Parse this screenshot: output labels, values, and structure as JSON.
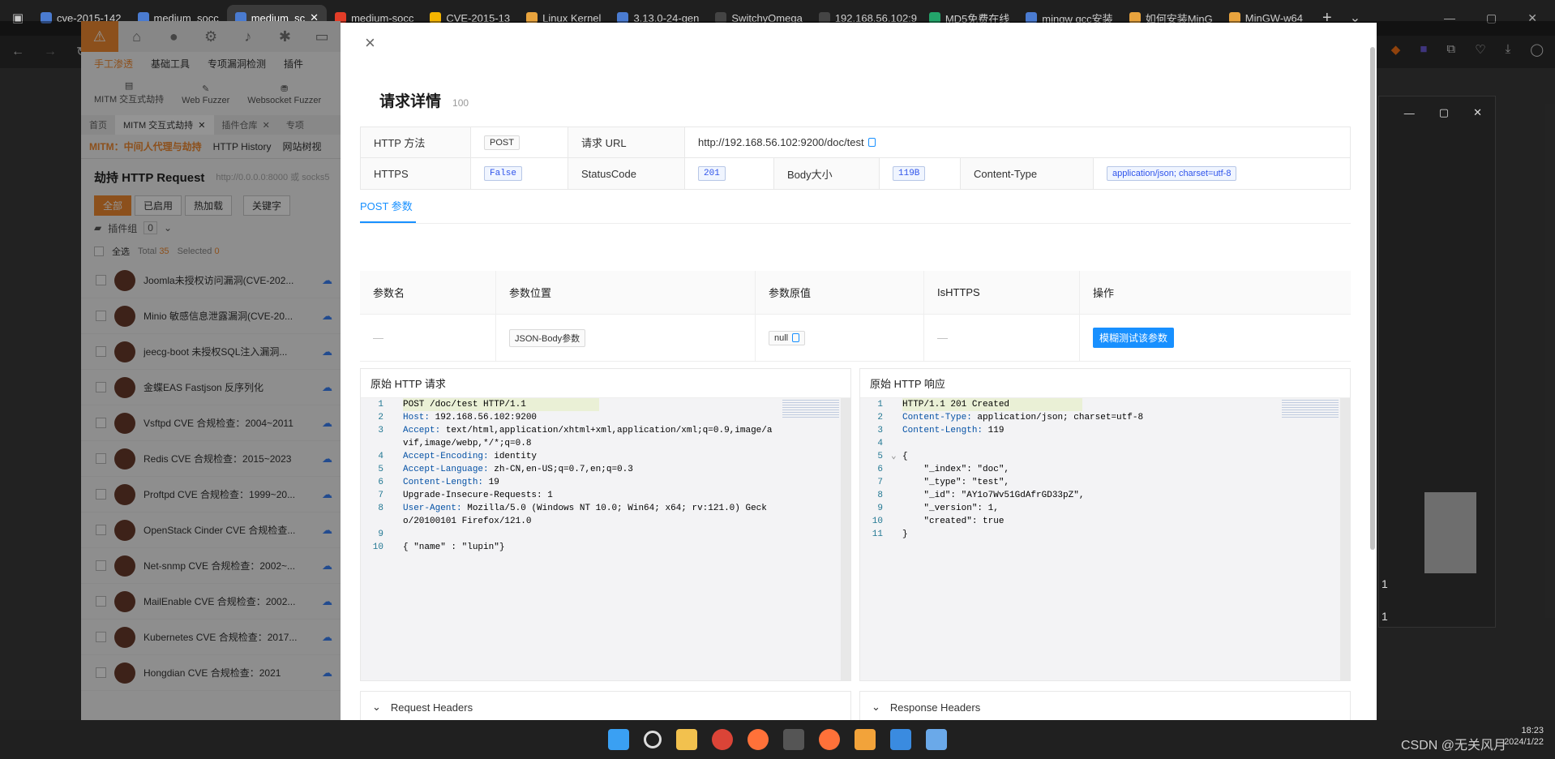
{
  "browser": {
    "tabs": [
      {
        "label": "cve-2015-142",
        "color": "#4a7bd0"
      },
      {
        "label": "medium_socc",
        "color": "#4a7bd0"
      },
      {
        "label": "medium_sc",
        "color": "#4a7bd0",
        "active": true
      },
      {
        "label": "medium-socc",
        "color": "#e23d28"
      },
      {
        "label": "CVE-2015-13",
        "color": "#f4b400"
      },
      {
        "label": "Linux Kernel",
        "color": "#e8a33d"
      },
      {
        "label": "3.13.0-24-gen",
        "color": "#4a7bd0"
      },
      {
        "label": "SwitchyOmega",
        "color": "#444"
      },
      {
        "label": "192.168.56.102:9",
        "color": "#444"
      },
      {
        "label": "MD5免费在线",
        "color": "#23a46a"
      },
      {
        "label": "mingw gcc安装",
        "color": "#4a7bd0"
      },
      {
        "label": "如何安装MinG",
        "color": "#e8a33d"
      },
      {
        "label": "MinGW-w64",
        "color": "#e8a33d"
      }
    ],
    "new_tab": "+",
    "dropdown": "⌄"
  },
  "app": {
    "menu": [
      "手工渗透",
      "基础工具",
      "专项漏洞检测",
      "插件"
    ],
    "tools": [
      "MITM 交互式劫持",
      "Web Fuzzer",
      "Websocket Fuzzer"
    ],
    "tabs": [
      "首页",
      "MITM 交互式劫持",
      "插件仓库",
      "专项"
    ],
    "sub_tabs": [
      "MITM：中间人代理与劫持",
      "HTTP History",
      "网站树视"
    ],
    "title": "劫持 HTTP Request",
    "title_hint": "http://0.0.0.0:8000 或 socks5",
    "filters": [
      "全部",
      "已启用",
      "热加载",
      "关键字"
    ],
    "plugin_group": "插件组",
    "plugin_group_count": "0",
    "select_all": "全选",
    "total_label": "Total",
    "total": "35",
    "selected_label": "Selected",
    "selected": "0",
    "plugins": [
      "Joomla未授权访问漏洞(CVE-202...",
      "Minio 敏感信息泄露漏洞(CVE-20...",
      "jeecg-boot 未授权SQL注入漏洞...",
      "金蝶EAS Fastjson 反序列化",
      "Vsftpd CVE 合规检查：2004~2011",
      "Redis CVE 合规检查：2015~2023",
      "Proftpd CVE 合规检查：1999~20...",
      "OpenStack Cinder CVE 合规检查...",
      "Net-snmp CVE 合规检查：2002~...",
      "MailEnable CVE 合规检查：2002...",
      "Kubernetes CVE 合规检查：2017...",
      "Hongdian CVE 合规检查：2021"
    ]
  },
  "modal": {
    "close": "×",
    "title": "请求详情",
    "id": "100",
    "labels": {
      "method": "HTTP 方法",
      "url": "请求 URL",
      "https": "HTTPS",
      "status": "StatusCode",
      "body_size": "Body大小",
      "content_type": "Content-Type"
    },
    "values": {
      "method": "POST",
      "url": "http://192.168.56.102:9200/doc/test",
      "https": "False",
      "status": "201",
      "body_size": "119B",
      "content_type": "application/json; charset=utf-8"
    },
    "post_tab": "POST 参数",
    "param_headers": [
      "参数名",
      "参数位置",
      "参数原值",
      "IsHTTPS",
      "操作"
    ],
    "param_row": {
      "name": "—",
      "position": "JSON-Body参数",
      "value": "null",
      "is_https": "—",
      "action": "模糊测试该参数"
    },
    "request_title": "原始 HTTP 请求",
    "response_title": "原始 HTTP 响应",
    "request_headers": "Request Headers",
    "response_headers": "Response Headers"
  },
  "request_lines": [
    {
      "n": "1",
      "k": "",
      "v": "POST /doc/test HTTP/1.1"
    },
    {
      "n": "2",
      "k": "Host:",
      "v": " 192.168.56.102:9200"
    },
    {
      "n": "3",
      "k": "Accept:",
      "v": " text/html,application/xhtml+xml,application/xml;q=0.9,image/avif,image/webp,*/*;q=0.8"
    },
    {
      "n": "4",
      "k": "Accept-Encoding:",
      "v": " identity"
    },
    {
      "n": "5",
      "k": "Accept-Language:",
      "v": " zh-CN,en-US;q=0.7,en;q=0.3"
    },
    {
      "n": "6",
      "k": "Content-Length:",
      "v": " 19"
    },
    {
      "n": "7",
      "k": "",
      "v": "Upgrade-Insecure-Requests: 1"
    },
    {
      "n": "8",
      "k": "User-Agent:",
      "v": " Mozilla/5.0 (Windows NT 10.0; Win64; x64; rv:121.0) Gecko/20100101 Firefox/121.0"
    },
    {
      "n": "9",
      "k": "",
      "v": ""
    },
    {
      "n": "10",
      "k": "",
      "v": "{ \"name\" : \"lupin\"}"
    }
  ],
  "response_lines": [
    {
      "n": "1",
      "k": "",
      "v": "HTTP/1.1 201 Created"
    },
    {
      "n": "2",
      "k": "Content-Type:",
      "v": " application/json; charset=utf-8"
    },
    {
      "n": "3",
      "k": "Content-Length:",
      "v": " 119"
    },
    {
      "n": "4",
      "k": "",
      "v": ""
    },
    {
      "n": "5",
      "k": "",
      "v": "{"
    },
    {
      "n": "6",
      "k": "",
      "v": "    \"_index\": \"doc\","
    },
    {
      "n": "7",
      "k": "",
      "v": "    \"_type\": \"test\","
    },
    {
      "n": "8",
      "k": "",
      "v": "    \"_id\": \"AY1o7Wv51GdAfrGD33pZ\","
    },
    {
      "n": "9",
      "k": "",
      "v": "    \"_version\": 1,"
    },
    {
      "n": "10",
      "k": "",
      "v": "    \"created\": true"
    },
    {
      "n": "11",
      "k": "",
      "v": "}"
    }
  ],
  "right_window": {
    "num1": "1",
    "num2": "1"
  },
  "tray": {
    "time": "18:23",
    "date": "2024/1/22",
    "watermark": "CSDN @无关风月"
  }
}
